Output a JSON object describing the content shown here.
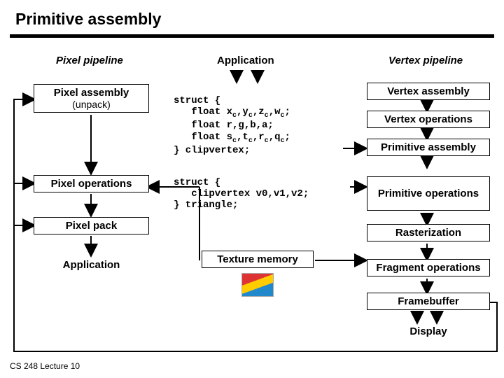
{
  "title": "Primitive assembly",
  "footer": "CS 248 Lecture 10",
  "headers": {
    "pixel": "Pixel pipeline",
    "app": "Application",
    "vertex": "Vertex pipeline"
  },
  "left": {
    "assembly": "Pixel assembly",
    "assembly_sub": "(unpack)",
    "ops": "Pixel operations",
    "pack": "Pixel pack",
    "app": "Application"
  },
  "center": {
    "texmem": "Texture memory"
  },
  "right": {
    "vassembly": "Vertex assembly",
    "vops": "Vertex operations",
    "passembly": "Primitive assembly",
    "pops": "Primitive operations",
    "raster": "Rasterization",
    "frag": "Fragment operations",
    "fb": "Framebuffer",
    "display": "Display"
  },
  "code": {
    "clipvertex": {
      "l1": "struct {",
      "l2a": "   float x",
      "l2b": ",y",
      "l2c": ",z",
      "l2d": ",w",
      "l2e": ";",
      "l3": "   float r,g,b,a;",
      "l4a": "   float s",
      "l4b": ",t",
      "l4c": ",r",
      "l4d": ",q",
      "l4e": ";",
      "l5": "} clipvertex;"
    },
    "triangle": {
      "l1": "struct {",
      "l2": "   clipvertex v0,v1,v2;",
      "l3": "} triangle;"
    },
    "sub_c": "c"
  }
}
